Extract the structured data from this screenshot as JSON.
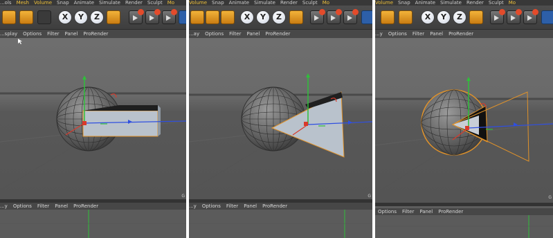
{
  "panels": [
    {
      "menubar": [
        "...ols",
        "Mesh",
        "Volume",
        "Snap",
        "Animate",
        "Simulate",
        "Render",
        "Sculpt",
        "Mo"
      ],
      "view_menu": [
        "...splay",
        "Options",
        "Filter",
        "Panel",
        "ProRender"
      ],
      "bottom_menu": [
        "...y",
        "Options",
        "Filter",
        "Panel",
        "ProRender"
      ],
      "corner_label": "G"
    },
    {
      "menubar": [
        "Volume",
        "Snap",
        "Animate",
        "Simulate",
        "Render",
        "Sculpt",
        "Mo"
      ],
      "view_menu": [
        "...ay",
        "Options",
        "Filter",
        "Panel",
        "ProRender"
      ],
      "bottom_menu": [
        "...y",
        "Options",
        "Filter",
        "Panel",
        "ProRender"
      ],
      "corner_label": "G"
    },
    {
      "menubar": [
        "Volume",
        "Snap",
        "Animate",
        "Simulate",
        "Render",
        "Sculpt",
        "Mo"
      ],
      "view_menu": [
        "...y",
        "Options",
        "Filter",
        "Panel",
        "ProRender"
      ],
      "bottom_menu": [
        "Options",
        "Filter",
        "Panel",
        "ProRender"
      ],
      "corner_label": "G"
    }
  ],
  "axis_buttons": [
    "X",
    "Y",
    "Z"
  ],
  "colors": {
    "selection_outline": "#e0922a",
    "axis_x": "#d93a2b",
    "axis_y": "#2fbf3a",
    "axis_z": "#2f4fe0",
    "toolbar_orange": "#e59a26"
  },
  "icons": [
    "undo-icon",
    "redo-icon",
    "move-tool-icon",
    "axis-x-icon",
    "axis-y-icon",
    "axis-z-icon",
    "world-coordinate-icon",
    "render-view-icon",
    "render-picture-icon",
    "edit-render-settings-icon",
    "cube-icon"
  ]
}
